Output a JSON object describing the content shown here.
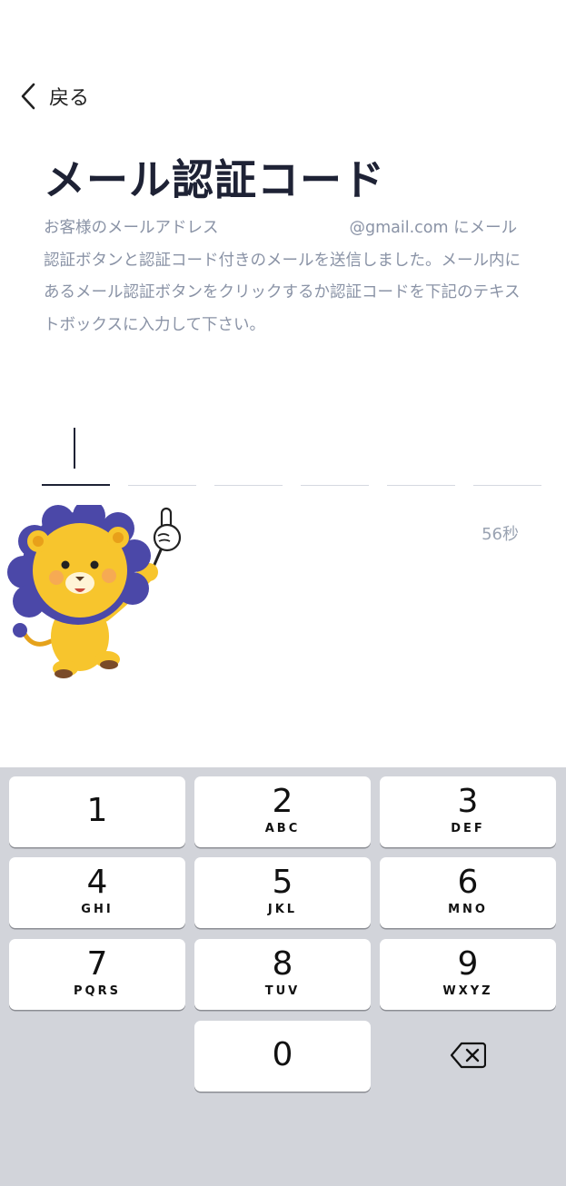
{
  "header": {
    "back_label": "戻る"
  },
  "title": "メール認証コード",
  "description": {
    "part1": "お客様のメールアドレス",
    "part2": "@gmail.com にメール認証ボタンと認証コード付きのメールを送信しました。メール内にあるメール認証ボタンをクリックするか認証コードを下記のテキストボックスに入力して下さい。"
  },
  "code": {
    "length": 6,
    "active_index": 0
  },
  "timer": "56秒",
  "keypad": {
    "keys": [
      {
        "num": "1",
        "letters": ""
      },
      {
        "num": "2",
        "letters": "ABC"
      },
      {
        "num": "3",
        "letters": "DEF"
      },
      {
        "num": "4",
        "letters": "GHI"
      },
      {
        "num": "5",
        "letters": "JKL"
      },
      {
        "num": "6",
        "letters": "MNO"
      },
      {
        "num": "7",
        "letters": "PQRS"
      },
      {
        "num": "8",
        "letters": "TUV"
      },
      {
        "num": "9",
        "letters": "WXYZ"
      },
      {
        "num": "0",
        "letters": ""
      }
    ],
    "delete_icon": "backspace-icon"
  },
  "colors": {
    "title": "#1e2235",
    "description": "#8a93a6",
    "timer": "#9aa3b2",
    "keypad_bg": "#d2d4da",
    "mascot_mane": "#4b48a8",
    "mascot_body": "#f7c52d"
  }
}
